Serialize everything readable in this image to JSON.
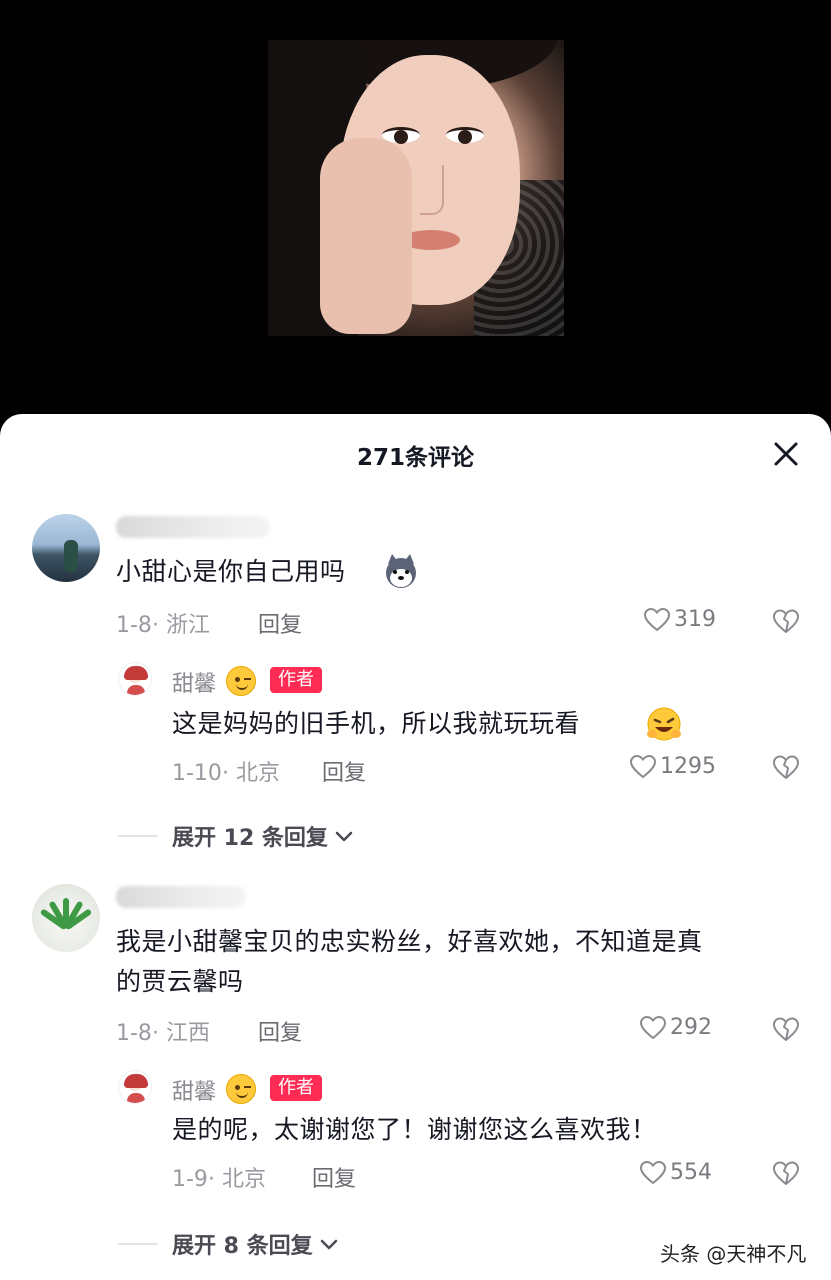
{
  "header": {
    "title": "271条评论",
    "close_icon": "close-icon"
  },
  "comments": [
    {
      "text": "小甜心是你自己用吗",
      "emoji": "husky-dog-emoji",
      "date": "1-8",
      "location": "浙江",
      "reply_label": "回复",
      "likes": "319",
      "reply": {
        "name": "甜馨",
        "badge": "作者",
        "text": "这是妈妈的旧手机，所以我就玩玩看",
        "emoji": "laughing-emoji",
        "date": "1-10",
        "location": "北京",
        "reply_label": "回复",
        "likes": "1295"
      },
      "expand_label": "展开 12 条回复"
    },
    {
      "text_line1": "我是小甜馨宝贝的忠实粉丝，好喜欢她，不知道是真",
      "text_line2": "的贾云馨吗",
      "date": "1-8",
      "location": "江西",
      "reply_label": "回复",
      "likes": "292",
      "reply": {
        "name": "甜馨",
        "badge": "作者",
        "text": "是的呢，太谢谢您了！谢谢您这么喜欢我！",
        "date": "1-9",
        "location": "北京",
        "reply_label": "回复",
        "likes": "554"
      },
      "expand_label": "展开 8 条回复"
    }
  ],
  "watermark": "头条 @天神不凡",
  "colors": {
    "badge": "#fe2c55",
    "sheet_bg": "#ffffff",
    "top_bg": "#000000"
  }
}
